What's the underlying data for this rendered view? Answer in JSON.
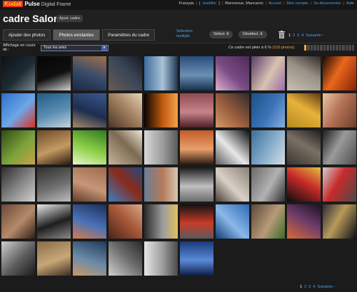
{
  "app": {
    "logo_brand": "Kodak",
    "logo_product": "Pulse",
    "logo_sub": "Digital Frame"
  },
  "topnav": {
    "language": "Français",
    "modify": "modifier",
    "welcome": "Bienvenue, Mancaron",
    "home": "Accueil",
    "account": "Mon compte",
    "logout": "Se déconnecter",
    "help": "Aide"
  },
  "header": {
    "title": "cadre Salon",
    "adjust_button": "Ajust. cadre"
  },
  "tabs": [
    {
      "label": "Ajouter des photos",
      "active": false
    },
    {
      "label": "Photos existantes",
      "active": true
    },
    {
      "label": "Paramètres du cadre",
      "active": false
    }
  ],
  "toolbar": {
    "multi_select": "Sélection multiple",
    "select_all": "Sélect. tt",
    "deselect_all": "Désélect. tt",
    "trash_icon": "trash-icon"
  },
  "pagination": {
    "pages": [
      "1",
      "2",
      "3",
      "4"
    ],
    "current": "1",
    "next": "Suivante ›"
  },
  "filter": {
    "label": "Affichage en cours de :",
    "selected": "Tous les amis"
  },
  "capacity": {
    "text_prefix": "Ce cadre est plein à 6 %",
    "text_count": "(210 photos)",
    "fill_fraction": 0.06,
    "highlight_color": "#f2a83b"
  },
  "colors": {
    "link": "#4aa3e8",
    "background": "#1b1b1b"
  },
  "thumbnails": [
    {
      "name": "dark-skyscraper",
      "colors": [
        "#0c1218",
        "#1e2b33",
        "#7d8890"
      ]
    },
    {
      "name": "dark-lamp",
      "colors": [
        "#050505",
        "#101010",
        "#cfcfcf"
      ]
    },
    {
      "name": "river-bridge-sunset",
      "colors": [
        "#a0704a",
        "#354a6c",
        "#1c2840"
      ]
    },
    {
      "name": "glass-building-evening",
      "colors": [
        "#6a5a54",
        "#3a4658",
        "#1a1a22"
      ]
    },
    {
      "name": "blue-glass-facade",
      "colors": [
        "#3d6b9c",
        "#a9c2d6",
        "#1d3552"
      ]
    },
    {
      "name": "blue-building-sky",
      "colors": [
        "#2a4c7c",
        "#6c8fb5",
        "#17304f"
      ]
    },
    {
      "name": "purple-flower",
      "colors": [
        "#4b2b57",
        "#7c4c86",
        "#e0b1d3"
      ]
    },
    {
      "name": "venice-mask",
      "colors": [
        "#5a3b6b",
        "#d9c2b0",
        "#9a6da8"
      ]
    },
    {
      "name": "eiffel-tower-fog",
      "colors": [
        "#c8c0b4",
        "#9a9186",
        "#2e2b28"
      ]
    },
    {
      "name": "bonfire",
      "colors": [
        "#8a1f08",
        "#e8681c",
        "#1a0603"
      ]
    },
    {
      "name": "blue-sky-flag",
      "colors": [
        "#2d6fc9",
        "#6ea6e8",
        "#d83222"
      ]
    },
    {
      "name": "sea-bench",
      "colors": [
        "#1f5b87",
        "#5a8db3",
        "#c9d2d8"
      ]
    },
    {
      "name": "cathedral-dusk",
      "colors": [
        "#3a5a8e",
        "#1d2d4f",
        "#a78a6a"
      ]
    },
    {
      "name": "glass-dome",
      "colors": [
        "#4a3426",
        "#a58463",
        "#e6d2b6"
      ]
    },
    {
      "name": "light-spiral",
      "colors": [
        "#0a0402",
        "#c05a12",
        "#f3a04a"
      ]
    },
    {
      "name": "pink-rose",
      "colors": [
        "#8f4a52",
        "#c8848a",
        "#4e1f26"
      ]
    },
    {
      "name": "ferris-wheel",
      "colors": [
        "#2f2a2e",
        "#9b5e3e",
        "#d59a68"
      ]
    },
    {
      "name": "blue-tiles",
      "colors": [
        "#1c4f88",
        "#3b74b7",
        "#87aede"
      ]
    },
    {
      "name": "fruit-market",
      "colors": [
        "#b38a1e",
        "#e8b23a",
        "#5e3a12"
      ]
    },
    {
      "name": "dolls",
      "colors": [
        "#6b3e2a",
        "#b7745a",
        "#e7c9a2"
      ]
    },
    {
      "name": "green-tunnel",
      "colors": [
        "#2e4a16",
        "#7ba33a",
        "#c9a14a"
      ]
    },
    {
      "name": "church-interior",
      "colors": [
        "#6b4a2a",
        "#c59a62",
        "#2a1a10"
      ]
    },
    {
      "name": "green-leaves",
      "colors": [
        "#2e7a1e",
        "#8fd04a",
        "#e8f6c8"
      ]
    },
    {
      "name": "hallway-light",
      "colors": [
        "#c7b59a",
        "#7c6a52",
        "#f0e6d4"
      ]
    },
    {
      "name": "white-lines",
      "colors": [
        "#d8d8d8",
        "#9c9c9c",
        "#5a5a5a"
      ]
    },
    {
      "name": "sunset-silhouette",
      "colors": [
        "#c25a2a",
        "#e8a06a",
        "#2a1812"
      ]
    },
    {
      "name": "black-white-stripes",
      "colors": [
        "#0c0c0c",
        "#e8e8e8",
        "#5c5c5c"
      ]
    },
    {
      "name": "pier-sea",
      "colors": [
        "#3c6e98",
        "#8ab0ce",
        "#d6dde2"
      ]
    },
    {
      "name": "cobblestones",
      "colors": [
        "#3a3632",
        "#7a7064",
        "#201e1c"
      ]
    },
    {
      "name": "street-shadow",
      "colors": [
        "#4c4c4c",
        "#9a9a9a",
        "#1c1c1c"
      ]
    },
    {
      "name": "escalator",
      "colors": [
        "#2c2c2c",
        "#8a8a8a",
        "#d0d0d0"
      ]
    },
    {
      "name": "crowd-bw",
      "colors": [
        "#2e2e2e",
        "#6e6e6e",
        "#bcbcbc"
      ]
    },
    {
      "name": "sand-dunes",
      "colors": [
        "#9c6a4e",
        "#c89678",
        "#5e3a2a"
      ]
    },
    {
      "name": "red-crane",
      "colors": [
        "#3c7cc0",
        "#8a2a1a",
        "#1e4a82"
      ]
    },
    {
      "name": "rooftops",
      "colors": [
        "#6a7e96",
        "#b47a5a",
        "#d8c8b0"
      ]
    },
    {
      "name": "bridge-bw",
      "colors": [
        "#1a1a1a",
        "#bfbfbf",
        "#6c6c6c"
      ]
    },
    {
      "name": "tabby-cat",
      "colors": [
        "#8c8076",
        "#d8d0c6",
        "#4a3e36"
      ]
    },
    {
      "name": "old-building",
      "colors": [
        "#6a6a6a",
        "#b2b2b2",
        "#2e2e2e"
      ]
    },
    {
      "name": "black-cat",
      "colors": [
        "#0c0c0c",
        "#c82a2a",
        "#e0c040"
      ]
    },
    {
      "name": "girl-red-dress",
      "colors": [
        "#4a4a4a",
        "#c82a2a",
        "#cfcfcf"
      ]
    },
    {
      "name": "diagonal-stripes",
      "colors": [
        "#6a4a36",
        "#b58a6a",
        "#2e1e16"
      ]
    },
    {
      "name": "people-silhouette",
      "colors": [
        "#e8e8e8",
        "#1e1e1e",
        "#8a8a8a"
      ]
    },
    {
      "name": "blue-reflection",
      "colors": [
        "#1c2e58",
        "#4a72b8",
        "#d87a4a"
      ]
    },
    {
      "name": "red-lines-wall",
      "colors": [
        "#4a2418",
        "#a85a3a",
        "#d8a888"
      ]
    },
    {
      "name": "diagonal-road",
      "colors": [
        "#2a2a2a",
        "#9c9c9c",
        "#e0c060"
      ]
    },
    {
      "name": "red-line-dark",
      "colors": [
        "#121212",
        "#c83c2a",
        "#5a5a5a"
      ]
    },
    {
      "name": "blue-glass-panels",
      "colors": [
        "#2e6ab4",
        "#8ab8ea",
        "#123c78"
      ]
    },
    {
      "name": "cat-face",
      "colors": [
        "#5a4a3a",
        "#b89a78",
        "#3c6a2a"
      ]
    },
    {
      "name": "paris-sunset",
      "colors": [
        "#d86a3a",
        "#6a3a6a",
        "#1a1220"
      ]
    },
    {
      "name": "night-lights",
      "colors": [
        "#0e0e14",
        "#b89a5a",
        "#2a2a3a"
      ]
    },
    {
      "name": "bw-walkway",
      "colors": [
        "#d0d0d0",
        "#5c5c5c",
        "#1a1a1a"
      ]
    },
    {
      "name": "love-locks",
      "colors": [
        "#8a6a4a",
        "#c8a878",
        "#3c2c20"
      ]
    },
    {
      "name": "photographer",
      "colors": [
        "#1e3a5a",
        "#6c8aa8",
        "#c89a6a"
      ]
    },
    {
      "name": "beach-bw",
      "colors": [
        "#cfcfcf",
        "#6a6a6a",
        "#2a2a2a"
      ]
    },
    {
      "name": "sky-bw",
      "colors": [
        "#e6e6e6",
        "#9c9c9c",
        "#4a4a4a"
      ]
    },
    {
      "name": "blue-stairs",
      "colors": [
        "#1a3a7c",
        "#5a8ad8",
        "#0e1e48"
      ]
    }
  ]
}
